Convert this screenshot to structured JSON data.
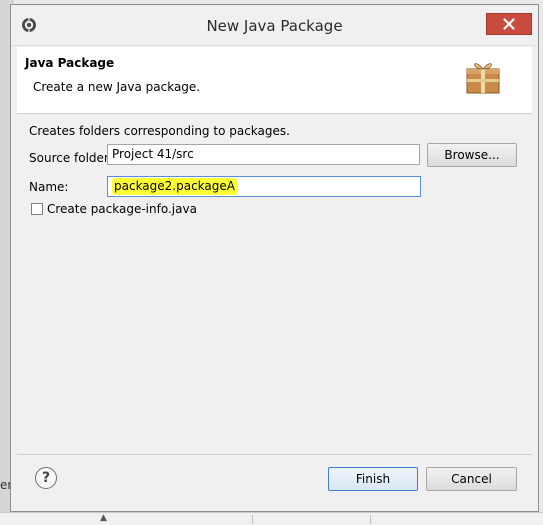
{
  "window": {
    "title": "New Java Package"
  },
  "banner": {
    "title": "Java Package",
    "description": "Create a new Java package."
  },
  "form": {
    "description": "Creates folders corresponding to packages.",
    "source_folder_label": "Source folder:",
    "source_folder_value": "Project 41/src",
    "browse_label": "Browse...",
    "name_label": "Name:",
    "name_value": "package2.packageA",
    "checkbox_label": "Create package-info.java",
    "checkbox_checked": false
  },
  "footer": {
    "help_label": "?",
    "finish_label": "Finish",
    "cancel_label": "Cancel"
  },
  "background": {
    "left_fragment": "er"
  },
  "colors": {
    "close_button": "#c74b3e",
    "highlight": "#ffff35",
    "focus_border": "#5a8ed6"
  }
}
